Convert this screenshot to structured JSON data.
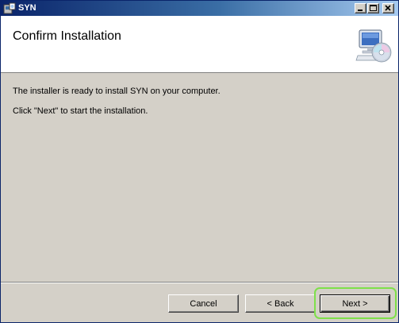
{
  "window": {
    "title": "SYN"
  },
  "header": {
    "title": "Confirm Installation",
    "icon": "installer-computer-cd-icon"
  },
  "main": {
    "line1": "The installer is ready to install SYN on your computer.",
    "line2": "Click \"Next\" to start the installation."
  },
  "buttons": {
    "cancel": "Cancel",
    "back": "< Back",
    "next": "Next >"
  },
  "colors": {
    "titlebar_start": "#0a246a",
    "titlebar_end": "#a6caf0",
    "dialog_bg": "#d4d0c8",
    "highlight": "#7ee04a"
  }
}
